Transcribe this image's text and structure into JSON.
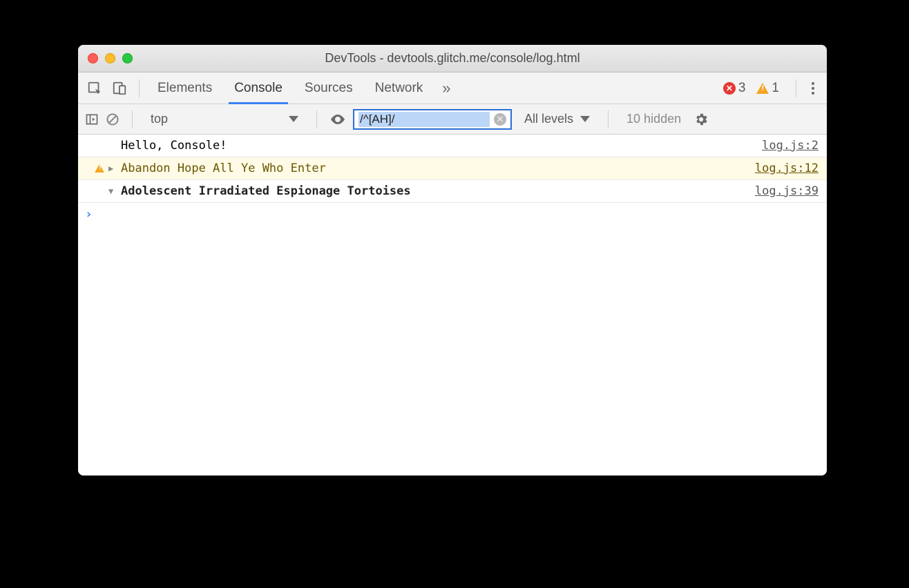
{
  "window": {
    "title": "DevTools - devtools.glitch.me/console/log.html"
  },
  "tabs": {
    "elements": "Elements",
    "console": "Console",
    "sources": "Sources",
    "network": "Network"
  },
  "status": {
    "errors": "3",
    "warnings": "1"
  },
  "toolbar": {
    "context": "top",
    "filter_value": "/^[AH]/",
    "levels": "All levels",
    "hidden": "10 hidden"
  },
  "logs": [
    {
      "msg": "Hello, Console!",
      "src": "log.js:2"
    },
    {
      "msg": "Abandon Hope All Ye Who Enter",
      "src": "log.js:12"
    },
    {
      "msg": "Adolescent Irradiated Espionage Tortoises",
      "src": "log.js:39"
    }
  ]
}
